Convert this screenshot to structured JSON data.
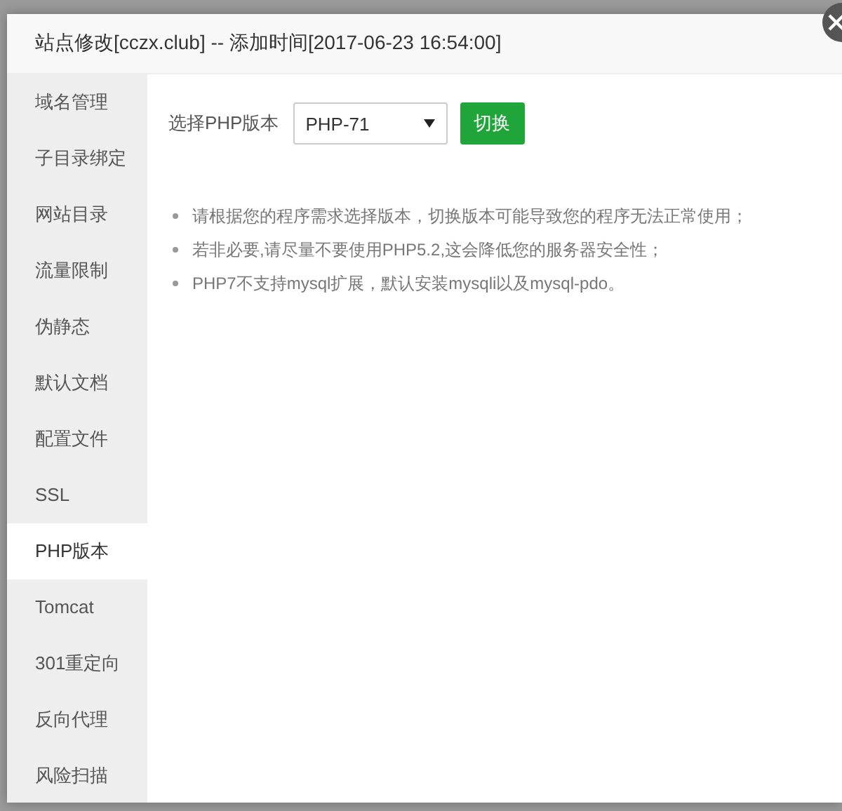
{
  "dialog": {
    "title": "站点修改[cczx.club] -- 添加时间[2017-06-23 16:54:00]",
    "sidebar": {
      "items": [
        {
          "label": "域名管理",
          "selected": false
        },
        {
          "label": "子目录绑定",
          "selected": false
        },
        {
          "label": "网站目录",
          "selected": false
        },
        {
          "label": "流量限制",
          "selected": false
        },
        {
          "label": "伪静态",
          "selected": false
        },
        {
          "label": "默认文档",
          "selected": false
        },
        {
          "label": "配置文件",
          "selected": false
        },
        {
          "label": "SSL",
          "selected": false
        },
        {
          "label": "PHP版本",
          "selected": true
        },
        {
          "label": "Tomcat",
          "selected": false
        },
        {
          "label": "301重定向",
          "selected": false
        },
        {
          "label": "反向代理",
          "selected": false
        },
        {
          "label": "风险扫描",
          "selected": false
        }
      ]
    },
    "php_version": {
      "label": "选择PHP版本",
      "select_value": "PHP-71",
      "button": "切换"
    },
    "notes": [
      "请根据您的程序需求选择版本，切换版本可能导致您的程序无法正常使用；",
      "若非必要,请尽量不要使用PHP5.2,这会降低您的服务器安全性；",
      "PHP7不支持mysql扩展，默认安装mysqli以及mysql-pdo。"
    ]
  }
}
